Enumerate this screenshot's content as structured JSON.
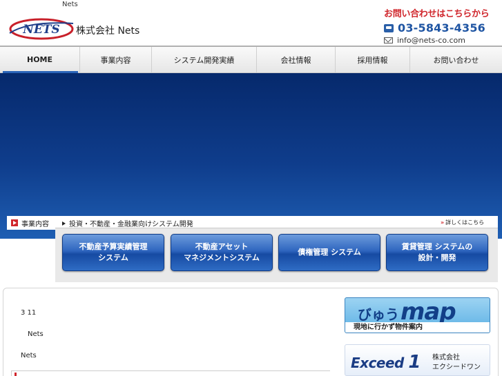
{
  "header": {
    "tagline": "Nets",
    "company_name": "株式会社 Nets",
    "logo_text": "NETS",
    "contact": {
      "title": "お問い合わせはこちらから",
      "phone": "03-5843-4356",
      "email": "info@nets-co.com"
    }
  },
  "nav": {
    "items": [
      {
        "label": "HOME",
        "active": true
      },
      {
        "label": "事業内容"
      },
      {
        "label": "システム開発実績"
      },
      {
        "label": "会社情報"
      },
      {
        "label": "採用情報"
      },
      {
        "label": "お問い合わせ"
      }
    ]
  },
  "business": {
    "label": "事業内容",
    "heading": "投資・不動産・金融業向けシステム開発",
    "more_link": "詳しくはこちら",
    "services": [
      {
        "line1": "不動産予算実績管理",
        "line2": "システム"
      },
      {
        "line1": "不動産アセット",
        "line2": "マネジメントシステム"
      },
      {
        "line1": "債権管理 システム",
        "line2": ""
      },
      {
        "line1": "賃貸管理 システムの",
        "line2": "設計・開発"
      }
    ]
  },
  "news": {
    "lines": [
      "3 11",
      "Nets",
      "Nets"
    ]
  },
  "banners": {
    "map": {
      "kana": "びゅう",
      "word": "map",
      "subtitle": "現地に行かず物件案内"
    },
    "exceed": {
      "logo": "Exceed",
      "logo_num": "1",
      "company_line1": "株式会社",
      "company_line2": "エクシードワン"
    }
  },
  "colors": {
    "accent_blue": "#1f55a3",
    "accent_red": "#d0262c",
    "hero_blue": "#0f3d8c"
  }
}
